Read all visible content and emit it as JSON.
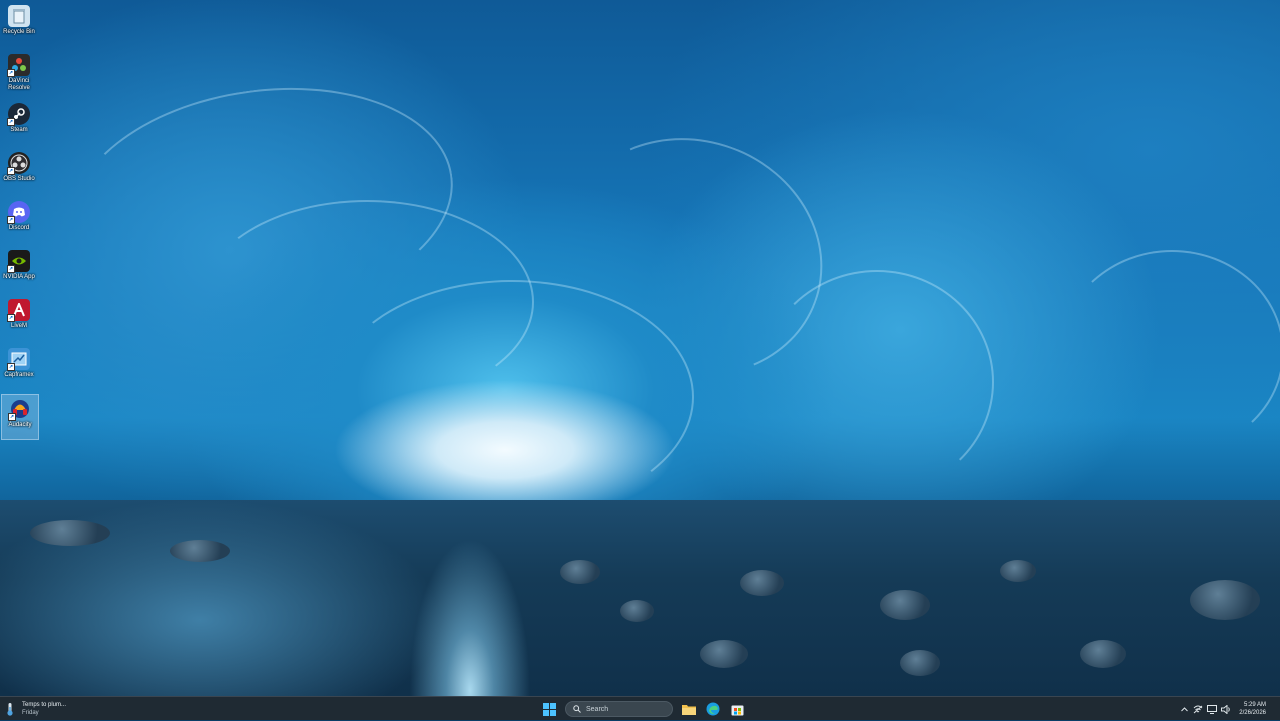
{
  "desktop": {
    "icons": [
      {
        "label": "Recycle Bin",
        "icon": "recycle-bin-icon",
        "color": "#cfe3f0"
      },
      {
        "label": "DaVinci Resolve",
        "icon": "davinci-resolve-icon",
        "color": "#2b2b2b"
      },
      {
        "label": "Steam",
        "icon": "steam-icon",
        "color": "#1b2838"
      },
      {
        "label": "OBS Studio",
        "icon": "obs-studio-icon",
        "color": "#222"
      },
      {
        "label": "Discord",
        "icon": "discord-icon",
        "color": "#5865f2"
      },
      {
        "label": "NVIDIA App",
        "icon": "nvidia-icon",
        "color": "#1a1a1a"
      },
      {
        "label": "LiveM",
        "icon": "livem-icon",
        "color": "#c0182f"
      },
      {
        "label": "Capframex",
        "icon": "capframex-icon",
        "color": "#3c93d6"
      },
      {
        "label": "Audacity",
        "icon": "audacity-icon",
        "color": "#1c3d8c"
      }
    ]
  },
  "taskbar": {
    "weather": {
      "title": "Temps to plum...",
      "subtitle": "Friday"
    },
    "search": {
      "placeholder": "Search"
    },
    "pinned": [
      "windows-start-icon",
      "file-explorer-icon",
      "edge-icon",
      "store-icon"
    ],
    "clock": {
      "time": "5:29 AM",
      "date": "2/26/2026"
    },
    "tray_icons": [
      "chevron-up-icon",
      "network-off-icon",
      "display-icon",
      "volume-icon"
    ]
  }
}
